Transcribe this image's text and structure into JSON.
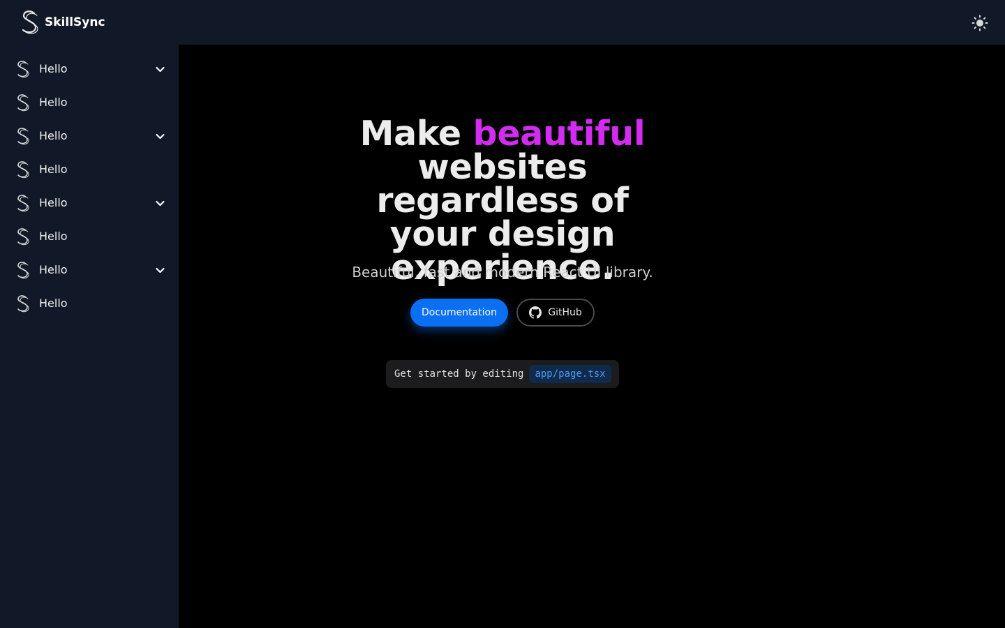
{
  "header": {
    "brand_name": "SkillSync",
    "logo_icon": "s-logo-icon",
    "theme_icon": "sun-icon"
  },
  "sidebar": {
    "items": [
      {
        "label": "Hello",
        "expandable": true
      },
      {
        "label": "Hello",
        "expandable": false
      },
      {
        "label": "Hello",
        "expandable": true
      },
      {
        "label": "Hello",
        "expandable": false
      },
      {
        "label": "Hello",
        "expandable": true
      },
      {
        "label": "Hello",
        "expandable": false
      },
      {
        "label": "Hello",
        "expandable": true
      },
      {
        "label": "Hello",
        "expandable": false
      }
    ]
  },
  "hero": {
    "title_before": "Make ",
    "title_accent": "beautiful",
    "title_after": " websites regardless of your design experience.",
    "subtitle": "Beautiful, fast and modern React UI library.",
    "primary_button": "Documentation",
    "secondary_button": "GitHub",
    "snippet_text": "Get started by editing",
    "snippet_code": "app/page.tsx"
  },
  "colors": {
    "accent": "#d22cf0",
    "primary": "#0a6ff0",
    "sidebar_bg": "#111827",
    "main_bg": "#000000"
  }
}
